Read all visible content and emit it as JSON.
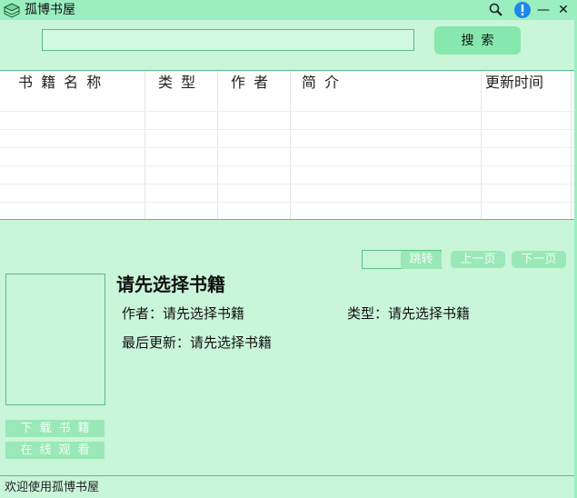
{
  "window": {
    "title": "孤博书屋",
    "accent": "#9aeec0",
    "background": "#c9f5d9"
  },
  "titlebar": {
    "icons": [
      "book-stack-icon",
      "search-icon",
      "info-icon",
      "minimize-icon",
      "close-icon"
    ],
    "minimize_glyph": "—",
    "close_glyph": "✕"
  },
  "search": {
    "value": "",
    "placeholder": "",
    "button_label": "搜索"
  },
  "table": {
    "columns": [
      "书 籍 名 称",
      "类 型",
      "作 者",
      "简 介",
      "更新时间"
    ],
    "rows": []
  },
  "pager": {
    "jump_value": "",
    "jump_label": "跳转",
    "prev_label": "上一页",
    "next_label": "下一页"
  },
  "detail": {
    "title": "请先选择书籍",
    "author_label": "作者：",
    "author_value": "请先选择书籍",
    "type_label": "类型：",
    "type_value": "请先选择书籍",
    "updated_label": "最后更新：",
    "updated_value": "请先选择书籍",
    "download_label": "下载书籍",
    "read_online_label": "在线观看"
  },
  "status": {
    "text": "欢迎使用孤博书屋"
  }
}
